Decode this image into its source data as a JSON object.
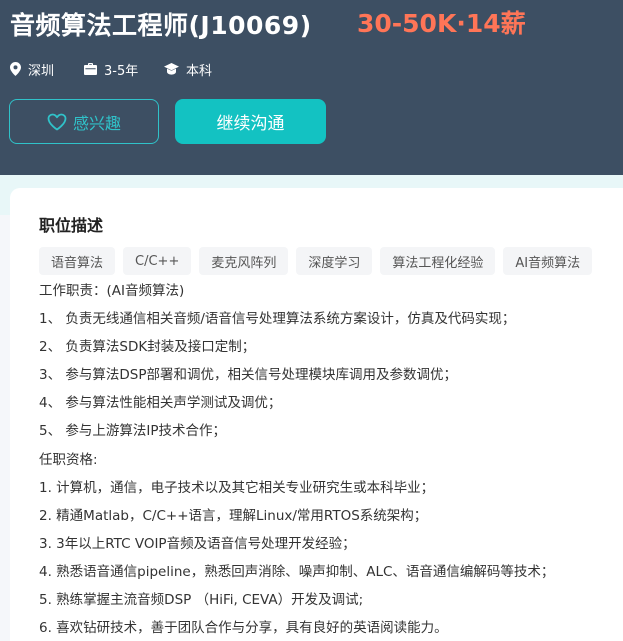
{
  "job": {
    "title": "音频算法工程师(J10069)",
    "salary": "30-50K·14薪",
    "location": "深圳",
    "experience": "3-5年",
    "education": "本科"
  },
  "actions": {
    "interest_label": "感兴趣",
    "chat_label": "继续沟通"
  },
  "description": {
    "section_title": "职位描述",
    "tags": [
      "语音算法",
      "C/C++",
      "麦克风阵列",
      "深度学习",
      "算法工程化经验",
      "AI音频算法"
    ],
    "lines": [
      "工作职责：(AI音频算法)",
      "1、 负责无线通信相关音频/语音信号处理算法系统方案设计，仿真及代码实现；",
      "2、 负责算法SDK封装及接口定制；",
      "3、 参与算法DSP部署和调优，相关信号处理模块库调用及参数调优；",
      "4、 参与算法性能相关声学测试及调优；",
      "5、 参与上游算法IP技术合作；",
      "任职资格:",
      "1. 计算机，通信，电子技术以及其它相关专业研究生或本科毕业；",
      "2. 精通Matlab，C/C++语言，理解Linux/常用RTOS系统架构；",
      "3. 3年以上RTC VOIP音频及语音信号处理开发经验；",
      "4. 熟悉语音通信pipeline，熟悉回声消除、噪声抑制、ALC、语音通信编解码等技术；",
      "5. 熟练掌握主流音频DSP （HiFi, CEVA）开发及调试;",
      "6. 喜欢钻研技术，善于团队合作与分享，具有良好的英语阅读能力。"
    ]
  },
  "icons": {
    "location": "location-pin-icon",
    "experience": "briefcase-icon",
    "education": "graduation-cap-icon",
    "interest": "heart-icon"
  },
  "colors": {
    "header_bg": "#3d4f63",
    "salary": "#ff7557",
    "accent": "#13c2c2"
  }
}
